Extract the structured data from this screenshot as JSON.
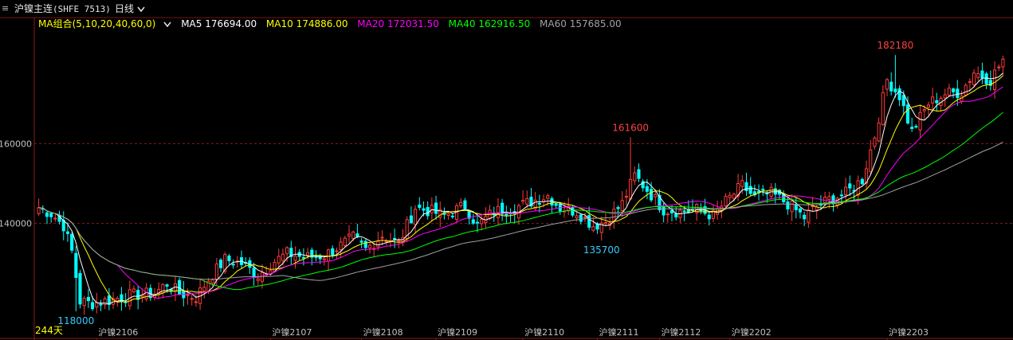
{
  "header": {
    "menu_icon": "≡",
    "title": "沪镍主连",
    "code": "(SHFE 7513)",
    "period": "日线",
    "period_icon": "chevron-down-icon"
  },
  "ma_legend": {
    "group": "MA组合(5,10,20,40,60,0)",
    "ma5": "MA5 176694.00",
    "ma10": "MA10 174886.00",
    "ma20": "MA20 172031.50",
    "ma40": "MA40 162916.50",
    "ma60": "MA60 157685.00"
  },
  "colors": {
    "up": "#ff3b3b",
    "down": "#00ffff",
    "ma5": "#ffffff",
    "ma10": "#ffff00",
    "ma20": "#ff00ff",
    "ma40": "#00ff00",
    "ma60": "#a0a0a0",
    "grid": "#8b1a1a",
    "axis_text": "#c0c0c0",
    "high_label": "#ff4040",
    "low_label": "#33ccff",
    "bar_count": "#ffff00"
  },
  "chart_data": {
    "type": "candlestick",
    "y_ticks": [
      160000,
      140000
    ],
    "y_tick_labels": [
      "160000",
      "140000"
    ],
    "ylim": [
      112000,
      188000
    ],
    "x_tick_labels": [
      {
        "label": "沪镍2106",
        "index": 14
      },
      {
        "label": "沪镍2107",
        "index": 56
      },
      {
        "label": "沪镍2108",
        "index": 78
      },
      {
        "label": "沪镍2109",
        "index": 96
      },
      {
        "label": "沪镍2110",
        "index": 117
      },
      {
        "label": "沪镍2111",
        "index": 135
      },
      {
        "label": "沪镍2112",
        "index": 150
      },
      {
        "label": "沪镍2202",
        "index": 167
      },
      {
        "label": "沪镍2203",
        "index": 205
      }
    ],
    "bar_count_label": "244天",
    "annotations": [
      {
        "text": "182180",
        "value": 182180,
        "index": 207,
        "kind": "high"
      },
      {
        "text": "161600",
        "value": 161600,
        "index": 143,
        "kind": "high"
      },
      {
        "text": "135700",
        "value": 135700,
        "index": 136,
        "kind": "low"
      },
      {
        "text": "118000",
        "value": 118000,
        "index": 9,
        "kind": "low"
      }
    ],
    "close_anchors": [
      [
        0,
        144000
      ],
      [
        3,
        142500
      ],
      [
        6,
        139500
      ],
      [
        8,
        133000
      ],
      [
        10,
        120500
      ],
      [
        13,
        120000
      ],
      [
        18,
        121000
      ],
      [
        22,
        122000
      ],
      [
        28,
        122500
      ],
      [
        31,
        125000
      ],
      [
        34,
        122500
      ],
      [
        38,
        121500
      ],
      [
        41,
        126000
      ],
      [
        45,
        131000
      ],
      [
        49,
        130000
      ],
      [
        53,
        127000
      ],
      [
        57,
        130500
      ],
      [
        60,
        132500
      ],
      [
        64,
        131500
      ],
      [
        69,
        132000
      ],
      [
        73,
        134500
      ],
      [
        76,
        136500
      ],
      [
        79,
        133500
      ],
      [
        83,
        137000
      ],
      [
        87,
        135000
      ],
      [
        91,
        144000
      ],
      [
        95,
        143000
      ],
      [
        98,
        142000
      ],
      [
        103,
        144500
      ],
      [
        106,
        139500
      ],
      [
        110,
        143000
      ],
      [
        115,
        144000
      ],
      [
        119,
        145500
      ],
      [
        123,
        147000
      ],
      [
        126,
        144000
      ],
      [
        130,
        143000
      ],
      [
        134,
        139500
      ],
      [
        137,
        140500
      ],
      [
        141,
        145000
      ],
      [
        144,
        152000
      ],
      [
        147,
        148500
      ],
      [
        151,
        143500
      ],
      [
        155,
        143000
      ],
      [
        159,
        143500
      ],
      [
        163,
        142000
      ],
      [
        166,
        145500
      ],
      [
        170,
        149500
      ],
      [
        173,
        146500
      ],
      [
        177,
        147500
      ],
      [
        181,
        145000
      ],
      [
        185,
        141500
      ],
      [
        187,
        143500
      ],
      [
        191,
        146000
      ],
      [
        195,
        147500
      ],
      [
        199,
        151000
      ],
      [
        202,
        162000
      ],
      [
        205,
        176000
      ],
      [
        208,
        172000
      ],
      [
        211,
        163000
      ],
      [
        215,
        170000
      ],
      [
        219,
        172500
      ],
      [
        223,
        173000
      ],
      [
        226,
        178000
      ],
      [
        230,
        176000
      ],
      [
        233,
        181000
      ]
    ],
    "total_bars": 234
  }
}
